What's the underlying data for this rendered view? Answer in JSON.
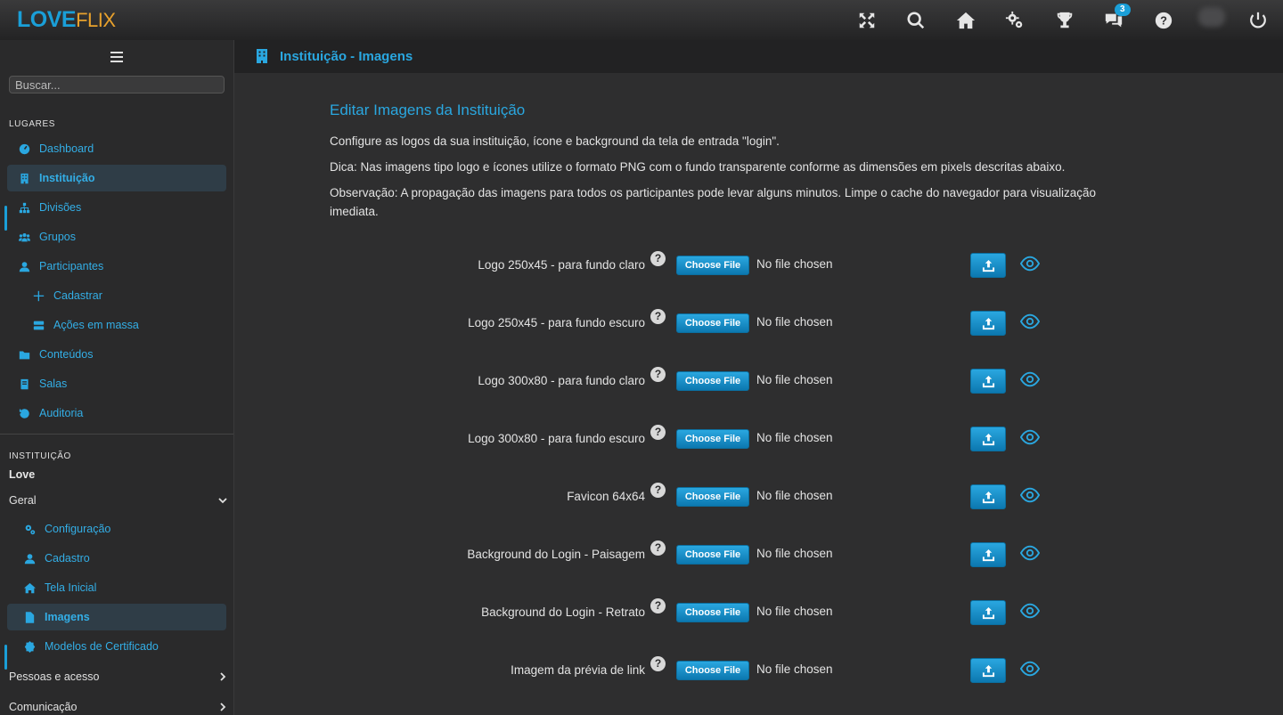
{
  "brand": {
    "love": "LOVE",
    "flix": "FLIX"
  },
  "topbar": {
    "icons": [
      "fullscreen-icon",
      "search-icon",
      "home-icon",
      "settings-icon",
      "trophy-icon",
      "chat-icon",
      "help-icon",
      "power-icon"
    ],
    "chat_badge": "3"
  },
  "sidebar": {
    "search_placeholder": "Buscar...",
    "section_places": "LUGARES",
    "places": [
      {
        "label": "Dashboard",
        "icon": "dashboard-icon"
      },
      {
        "label": "Instituição",
        "icon": "building-icon"
      },
      {
        "label": "Divisões",
        "icon": "hierarchy-icon"
      },
      {
        "label": "Grupos",
        "icon": "users-icon"
      },
      {
        "label": "Participantes",
        "icon": "user-icon"
      },
      {
        "label": "Cadastrar",
        "icon": "plus-icon"
      },
      {
        "label": "Ações em massa",
        "icon": "server-icon"
      },
      {
        "label": "Conteúdos",
        "icon": "folder-icon"
      },
      {
        "label": "Salas",
        "icon": "book-icon"
      },
      {
        "label": "Auditoria",
        "icon": "history-icon"
      }
    ],
    "section_institution": "INSTITUIÇÃO",
    "institution_name": "Love",
    "group_general": "Geral",
    "general_items": [
      {
        "label": "Configuração",
        "icon": "cogs-icon"
      },
      {
        "label": "Cadastro",
        "icon": "user-icon"
      },
      {
        "label": "Tela Inicial",
        "icon": "home-icon"
      },
      {
        "label": "Imagens",
        "icon": "file-icon"
      },
      {
        "label": "Modelos de Certificado",
        "icon": "certificate-icon"
      }
    ],
    "group_people": "Pessoas e acesso",
    "group_communication": "Comunicação"
  },
  "header": {
    "title": "Instituição - Imagens"
  },
  "main": {
    "heading": "Editar Imagens da Instituição",
    "intro": "Configure as logos da sua instituição, ícone e background da tela de entrada \"login\".",
    "tip": "Dica: Nas imagens tipo logo e ícones utilize o formato PNG com o fundo transparente conforme as dimensões em pixels descritas abaixo.",
    "note": "Observação: A propagação das imagens para todos os participantes pode levar alguns minutos. Limpe o cache do navegador para visualização imediata.",
    "choose_label": "Choose File",
    "no_file_label": "No file chosen",
    "help_glyph": "?",
    "rows": [
      {
        "label": "Logo 250x45 - para fundo claro"
      },
      {
        "label": "Logo 250x45 - para fundo escuro"
      },
      {
        "label": "Logo 300x80 - para fundo claro"
      },
      {
        "label": "Logo 300x80 - para fundo escuro"
      },
      {
        "label": "Favicon 64x64"
      },
      {
        "label": "Background do Login - Paisagem"
      },
      {
        "label": "Background do Login - Retrato"
      },
      {
        "label": "Imagem da prévia de link"
      }
    ]
  },
  "colors": {
    "accent": "#1a9fd8",
    "brand_orange": "#e8a12c",
    "background": "#2e2e2f"
  }
}
